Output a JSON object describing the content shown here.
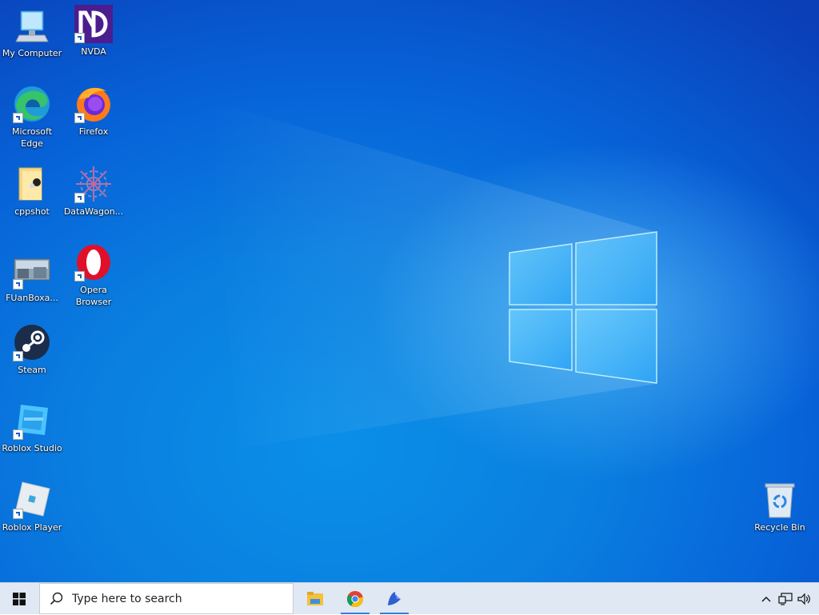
{
  "desktop": {
    "icons": {
      "my_computer": "My Computer",
      "nvda": "NVDA",
      "edge": "Microsoft Edge",
      "firefox": "Firefox",
      "cppshot": "cppshot",
      "datawagon": "DataWagon...",
      "fuanbox": "FUanBoxa...",
      "opera": "Opera Browser",
      "steam": "Steam",
      "roblox_studio": "Roblox Studio",
      "roblox_player": "Roblox Player",
      "recycle_bin": "Recycle Bin"
    }
  },
  "taskbar": {
    "search_placeholder": "Type here to search",
    "pinned_apps": [
      "file-explorer",
      "chrome",
      "app-bird"
    ],
    "tray_icons": [
      "chevron-up-icon",
      "network-icon",
      "volume-icon"
    ]
  },
  "colors": {
    "wallpaper_blue": "#0a7fe0",
    "taskbar_bg": "#dfe8f3",
    "active_indicator": "#3a7bd5"
  }
}
